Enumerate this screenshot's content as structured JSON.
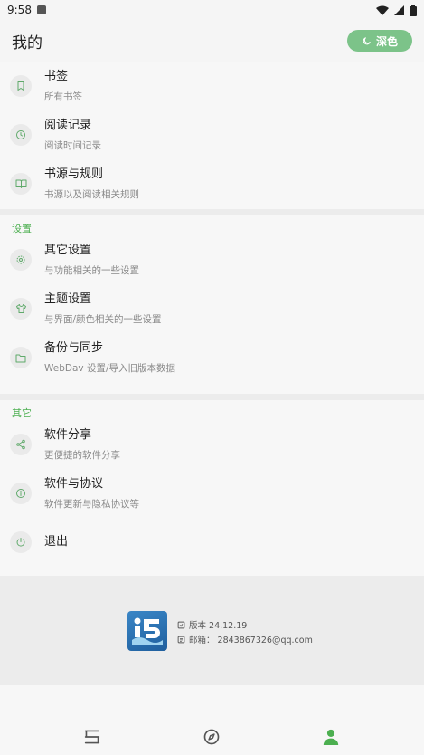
{
  "status_bar": {
    "time": "9:58"
  },
  "header": {
    "title": "我的",
    "dark_mode_label": "深色"
  },
  "top_items": [
    {
      "icon": "bookmark-icon",
      "label": "书签",
      "sub": "所有书签"
    },
    {
      "icon": "clock-icon",
      "label": "阅读记录",
      "sub": "阅读时间记录"
    },
    {
      "icon": "book-open-icon",
      "label": "书源与规则",
      "sub": "书源以及阅读相关规则"
    }
  ],
  "settings": {
    "header": "设置",
    "items": [
      {
        "icon": "gear-icon",
        "label": "其它设置",
        "sub": "与功能相关的一些设置"
      },
      {
        "icon": "shirt-icon",
        "label": "主题设置",
        "sub": "与界面/颜色相关的一些设置"
      },
      {
        "icon": "folder-icon",
        "label": "备份与同步",
        "sub": "WebDav 设置/导入旧版本数据"
      }
    ]
  },
  "others": {
    "header": "其它",
    "items": [
      {
        "icon": "share-icon",
        "label": "软件分享",
        "sub": "更便捷的软件分享"
      },
      {
        "icon": "info-icon",
        "label": "软件与协议",
        "sub": "软件更新与隐私协议等"
      },
      {
        "icon": "power-icon",
        "label": "退出",
        "sub": ""
      }
    ]
  },
  "footer": {
    "version": "版本 24.12.19",
    "email": "邮箱： 2843867326@qq.com"
  },
  "colors": {
    "accent": "#4caf50",
    "dark_button": "#7cc389",
    "icon_green": "#5fa96a"
  },
  "bottom_nav": [
    {
      "icon": "bookshelf-icon",
      "active": false
    },
    {
      "icon": "compass-icon",
      "active": false
    },
    {
      "icon": "person-icon",
      "active": true
    }
  ]
}
